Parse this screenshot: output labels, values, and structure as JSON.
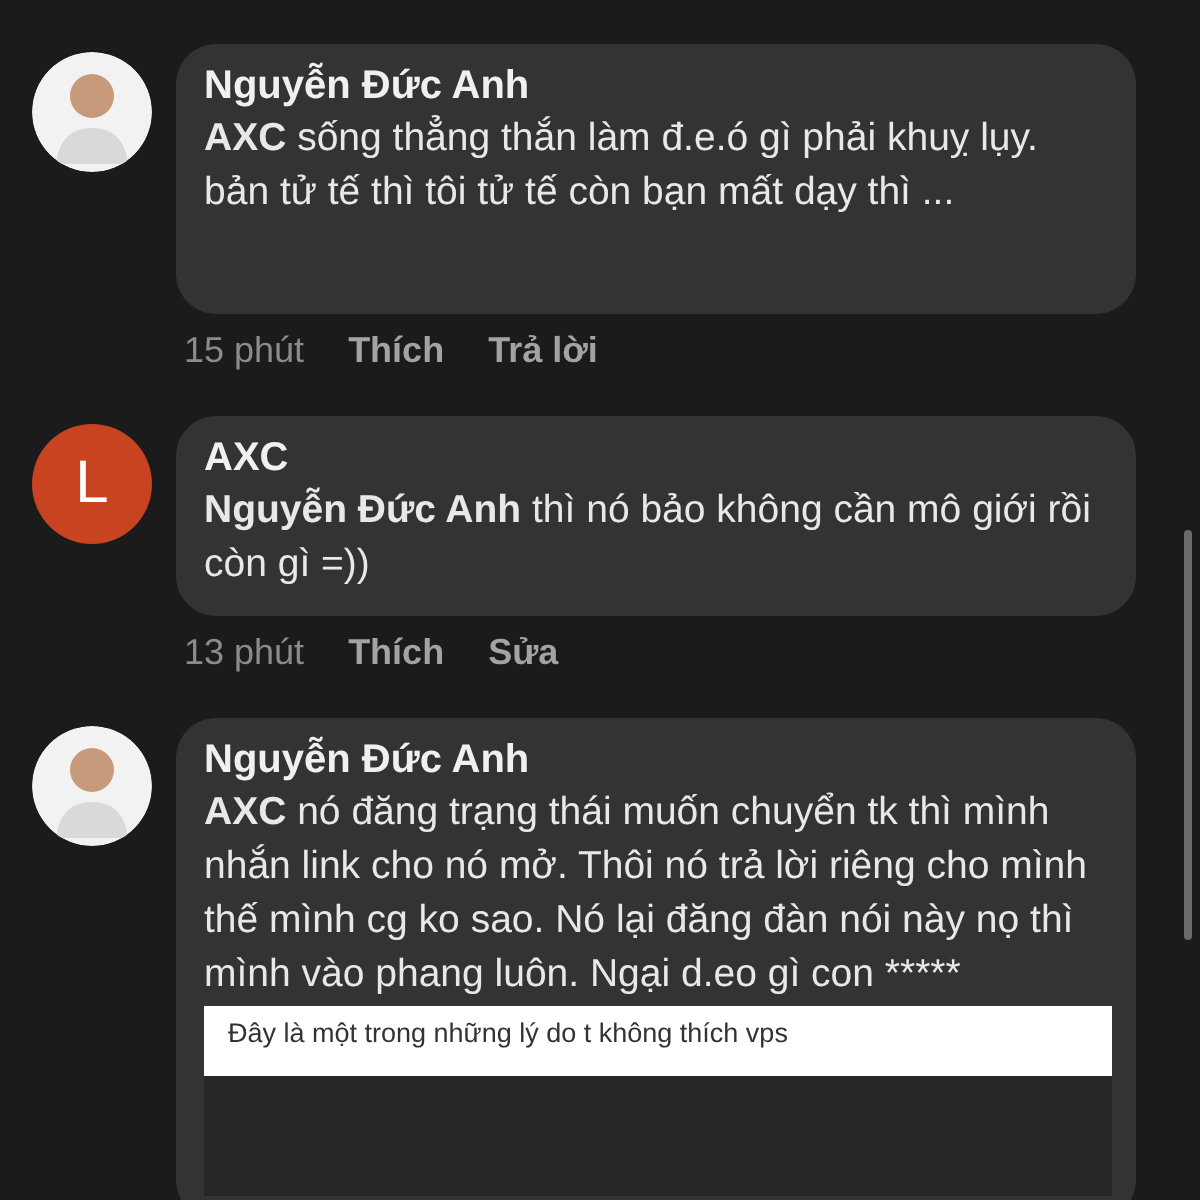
{
  "comments": [
    {
      "avatar": {
        "kind": "photo"
      },
      "author": "Nguyễn Đức Anh",
      "mention": "AXC",
      "body": "sống thẳng thắn làm đ.e.ó gì phải khuỵ lụy. bản tử tế thì tôi tử tế còn bạn mất dạy thì ...",
      "time": "15 phút",
      "actions": [
        "Thích",
        "Trả lời"
      ]
    },
    {
      "avatar": {
        "kind": "letter",
        "letter": "L",
        "color": "#c8431f"
      },
      "author": "AXC",
      "mention": "Nguyễn Đức Anh",
      "body": "thì nó bảo không cần mô giới rồi còn gì =))",
      "time": "13 phút",
      "actions": [
        "Thích",
        "Sửa"
      ]
    },
    {
      "avatar": {
        "kind": "photo"
      },
      "author": "Nguyễn Đức Anh",
      "mention": "AXC",
      "body": "nó đăng trạng thái muốn chuyển tk thì mình nhắn link cho nó mở. Thôi nó trả lời riêng cho mình thế mình cg ko sao. Nó lại đăng đàn nói này nọ thì mình vào phang luôn. Ngại d.eo gì con *****",
      "attachment": {
        "caption": "Đây là một trong những lý do t không thích vps"
      }
    }
  ]
}
